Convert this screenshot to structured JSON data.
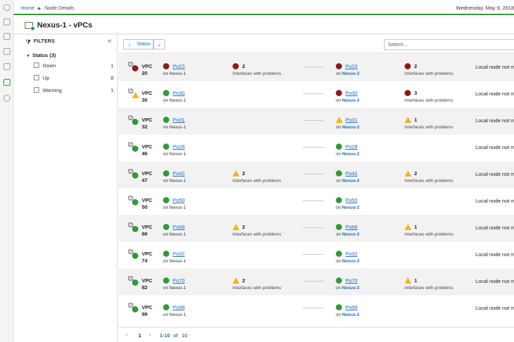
{
  "breadcrumb": {
    "home": "Home",
    "current": "Node Details"
  },
  "date": "Wednesday, May 9, 2018",
  "page_title": "Nexus-1 - vPCs",
  "filters": {
    "title": "FILTERS",
    "group": "Status (3)",
    "items": [
      {
        "label": "Down",
        "count": "1"
      },
      {
        "label": "Up",
        "count": "8"
      },
      {
        "label": "Warning",
        "count": "1"
      }
    ]
  },
  "toolbar": {
    "sort_label": "Status",
    "search_placeholder": "Search..."
  },
  "colors": {
    "ok": "#2e9a3a",
    "down": "#8b1a1a",
    "warning": "#f1b51c",
    "link": "#1a6ab4"
  },
  "rows": [
    {
      "type": "VPC",
      "num": "20",
      "status": "down",
      "a_status": "down",
      "a_pc": "Po23",
      "a_on": "on Nexus-1",
      "a_prob_status": "down",
      "a_prob": "2",
      "a_prob_txt": "Interfaces with problems",
      "b_status": "down",
      "b_pc": "Po23",
      "b_on": "on",
      "b_node": "Nexus-2",
      "b_prob_status": "down",
      "b_prob": "2",
      "b_prob_txt": "Interfaces with problems",
      "local": "Local node not mo"
    },
    {
      "type": "VPC",
      "num": "30",
      "status": "warn",
      "a_status": "ok",
      "a_pc": "Po30",
      "a_on": "on Nexus-1",
      "a_prob_status": "",
      "a_prob": "",
      "a_prob_txt": "",
      "b_status": "down",
      "b_pc": "Po30",
      "b_on": "on",
      "b_node": "Nexus-2",
      "b_prob_status": "down",
      "b_prob": "3",
      "b_prob_txt": "Interfaces with problems",
      "local": "Local node not mo"
    },
    {
      "type": "VPC",
      "num": "32",
      "status": "ok",
      "a_status": "ok",
      "a_pc": "Po31",
      "a_on": "on Nexus-1",
      "a_prob_status": "",
      "a_prob": "",
      "a_prob_txt": "",
      "b_status": "warn",
      "b_pc": "Po31",
      "b_on": "on",
      "b_node": "Nexus-2",
      "b_prob_status": "warn",
      "b_prob": "1",
      "b_prob_txt": "Interfaces with problems",
      "local": "Local node not mo"
    },
    {
      "type": "VPC",
      "num": "46",
      "status": "ok",
      "a_status": "ok",
      "a_pc": "Po28",
      "a_on": "on Nexus-1",
      "a_prob_status": "",
      "a_prob": "",
      "a_prob_txt": "",
      "b_status": "ok",
      "b_pc": "Po28",
      "b_on": "on",
      "b_node": "Nexus-2",
      "b_prob_status": "",
      "b_prob": "",
      "b_prob_txt": "",
      "local": "Local node not mo"
    },
    {
      "type": "VPC",
      "num": "47",
      "status": "ok",
      "a_status": "ok",
      "a_pc": "Po42",
      "a_on": "on Nexus-1",
      "a_prob_status": "warn",
      "a_prob": "2",
      "a_prob_txt": "Interfaces with problems",
      "b_status": "ok",
      "b_pc": "Po42",
      "b_on": "on",
      "b_node": "Nexus-2",
      "b_prob_status": "warn",
      "b_prob": "2",
      "b_prob_txt": "Interfaces with problems",
      "local": "Local node not mo"
    },
    {
      "type": "VPC",
      "num": "50",
      "status": "ok",
      "a_status": "ok",
      "a_pc": "Po50",
      "a_on": "on Nexus-1",
      "a_prob_status": "",
      "a_prob": "",
      "a_prob_txt": "",
      "b_status": "ok",
      "b_pc": "Po50",
      "b_on": "on",
      "b_node": "Nexus-2",
      "b_prob_status": "",
      "b_prob": "",
      "b_prob_txt": "",
      "local": "Local node not mo"
    },
    {
      "type": "VPC",
      "num": "66",
      "status": "ok",
      "a_status": "ok",
      "a_pc": "Po68",
      "a_on": "on Nexus-1",
      "a_prob_status": "warn",
      "a_prob": "2",
      "a_prob_txt": "Interfaces with problems",
      "b_status": "ok",
      "b_pc": "Po68",
      "b_on": "on",
      "b_node": "Nexus-2",
      "b_prob_status": "warn",
      "b_prob": "1",
      "b_prob_txt": "Interfaces with problems",
      "local": "Local node not mo"
    },
    {
      "type": "VPC",
      "num": "74",
      "status": "ok",
      "a_status": "ok",
      "a_pc": "Po32",
      "a_on": "on Nexus-1",
      "a_prob_status": "",
      "a_prob": "",
      "a_prob_txt": "",
      "b_status": "ok",
      "b_pc": "Po32",
      "b_on": "on",
      "b_node": "Nexus-2",
      "b_prob_status": "",
      "b_prob": "",
      "b_prob_txt": "",
      "local": "Local node not mo"
    },
    {
      "type": "VPC",
      "num": "82",
      "status": "ok",
      "a_status": "ok",
      "a_pc": "Po70",
      "a_on": "on Nexus-1",
      "a_prob_status": "warn",
      "a_prob": "2",
      "a_prob_txt": "Interfaces with problems",
      "b_status": "ok",
      "b_pc": "Po70",
      "b_on": "on",
      "b_node": "Nexus-2",
      "b_prob_status": "warn",
      "b_prob": "1",
      "b_prob_txt": "Interfaces with problems",
      "local": "Local node not mo"
    },
    {
      "type": "VPC",
      "num": "99",
      "status": "ok",
      "a_status": "ok",
      "a_pc": "Po99",
      "a_on": "on Nexus-1",
      "a_prob_status": "",
      "a_prob": "",
      "a_prob_txt": "",
      "b_status": "ok",
      "b_pc": "Po99",
      "b_on": "on",
      "b_node": "Nexus-2",
      "b_prob_status": "",
      "b_prob": "",
      "b_prob_txt": "",
      "local": "Local node not mo"
    }
  ],
  "pager": {
    "page": "1",
    "range": "1-10",
    "of": "of",
    "total": "10"
  }
}
